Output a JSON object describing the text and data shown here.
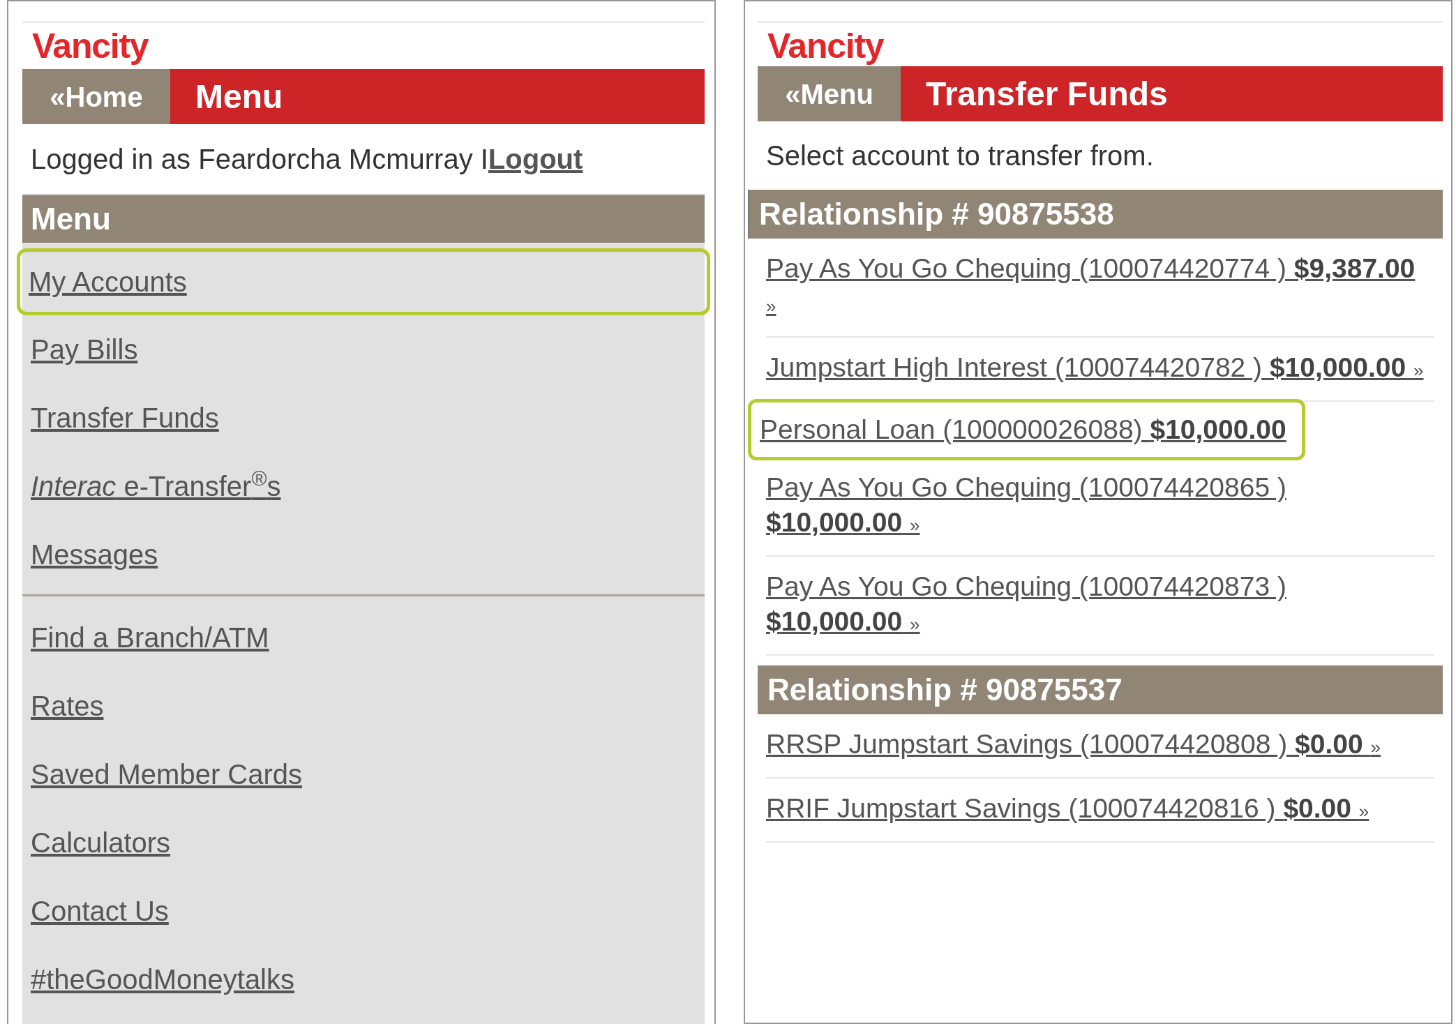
{
  "screens": [
    {
      "logo": "Vancity",
      "back_button": "«Home",
      "title": "Menu",
      "login": {
        "text": "Logged in as Feardorcha Mcmurray I ",
        "link": "Logout"
      },
      "section_heading": "Menu",
      "menu_groups": [
        [
          {
            "label": "My Accounts",
            "selected": true
          },
          {
            "label": "Pay Bills",
            "selected": false
          },
          {
            "label": "Transfer Funds",
            "selected": false
          },
          {
            "label": "*Interac* e-Transfer$^{®}$s",
            "selected": false
          },
          {
            "label": "Messages",
            "selected": false
          }
        ],
        [
          {
            "label": "Find a Branch/ATM",
            "selected": false
          },
          {
            "label": "Rates",
            "selected": false
          },
          {
            "label": "Saved Member Cards",
            "selected": false
          },
          {
            "label": "Calculators",
            "selected": false
          },
          {
            "label": "Contact Us",
            "selected": false
          },
          {
            "label": "#theGoodMoneytalks",
            "selected": false
          }
        ]
      ]
    },
    {
      "logo": "Vancity",
      "back_button": "«Menu",
      "title": "Transfer Funds",
      "instruction": "Select account to transfer from.",
      "relationships": [
        {
          "heading": "Relationship # 90875538",
          "accounts": [
            {
              "name": "Pay As You Go Chequing (100074420774 )",
              "amount": "$9,387.00",
              "arrow": "»",
              "selected": false
            },
            {
              "name": "Jumpstart High Interest (100074420782 )",
              "amount": "$10,000.00",
              "arrow": "»",
              "selected": false
            },
            {
              "name": "Personal Loan (100000026088)",
              "amount": "$10,000.00",
              "selected": true
            },
            {
              "name": "Pay As You Go Chequing (100074420865 )",
              "amount": "$10,000.00",
              "arrow": "»",
              "selected": false
            },
            {
              "name": "Pay As You Go Chequing (100074420873 )",
              "amount": "$10,000.00",
              "arrow": "»",
              "selected": false
            }
          ]
        },
        {
          "heading": "Relationship # 90875537",
          "accounts": [
            {
              "name": "RRSP Jumpstart Savings (100074420808 )",
              "amount": "$0.00",
              "arrow": "»",
              "selected": false
            },
            {
              "name": "RRIF Jumpstart Savings (100074420816 )",
              "amount": "$0.00",
              "arrow": "»",
              "selected": false
            }
          ]
        }
      ]
    }
  ]
}
